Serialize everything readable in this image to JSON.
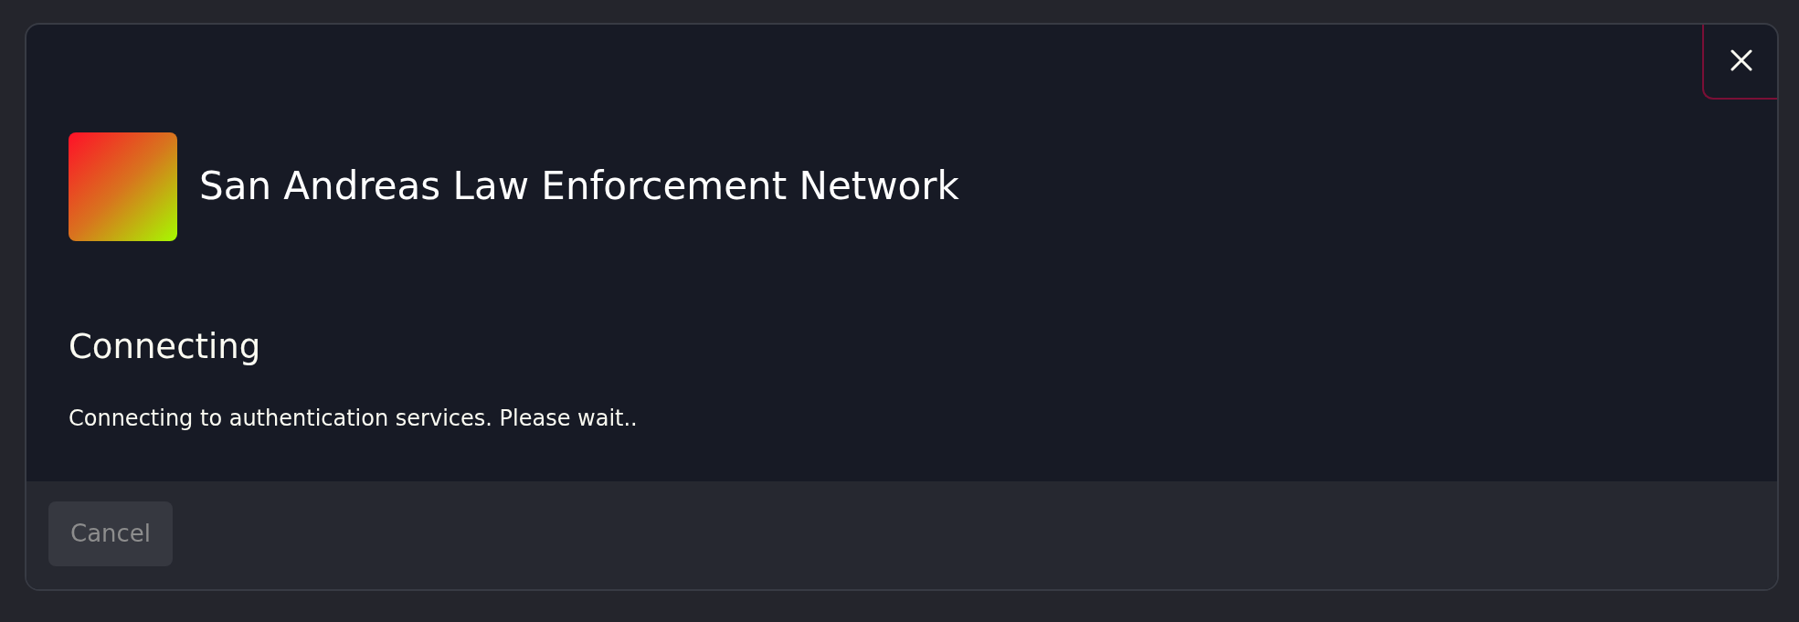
{
  "dialog": {
    "title": "San Andreas Law Enforcement Network",
    "heading": "Connecting",
    "message": "Connecting to authentication services. Please wait..",
    "buttons": [
      {
        "label": "Cancel",
        "disabled": true
      }
    ]
  }
}
